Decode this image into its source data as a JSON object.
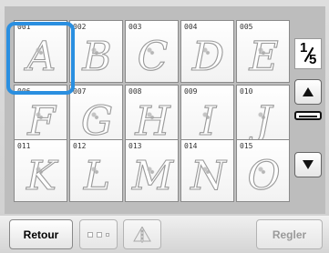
{
  "tiles": [
    {
      "num": "001",
      "letter": "A"
    },
    {
      "num": "002",
      "letter": "B"
    },
    {
      "num": "003",
      "letter": "C"
    },
    {
      "num": "004",
      "letter": "D"
    },
    {
      "num": "005",
      "letter": "E"
    },
    {
      "num": "006",
      "letter": "F"
    },
    {
      "num": "007",
      "letter": "G"
    },
    {
      "num": "008",
      "letter": "H"
    },
    {
      "num": "009",
      "letter": "I"
    },
    {
      "num": "010",
      "letter": "J"
    },
    {
      "num": "011",
      "letter": "K"
    },
    {
      "num": "012",
      "letter": "L"
    },
    {
      "num": "013",
      "letter": "M"
    },
    {
      "num": "014",
      "letter": "N"
    },
    {
      "num": "015",
      "letter": "O"
    }
  ],
  "selected_tile": "001",
  "page": {
    "current": "1",
    "total": "5"
  },
  "icons": {
    "scroll_up": "up-arrow-icon",
    "scroll_down": "down-arrow-icon",
    "layout": "layout-icon",
    "mirror": "mirror-icon"
  },
  "buttons": {
    "back": "Retour",
    "set": "Regler"
  },
  "colors": {
    "selection": "#2a8fe0"
  }
}
